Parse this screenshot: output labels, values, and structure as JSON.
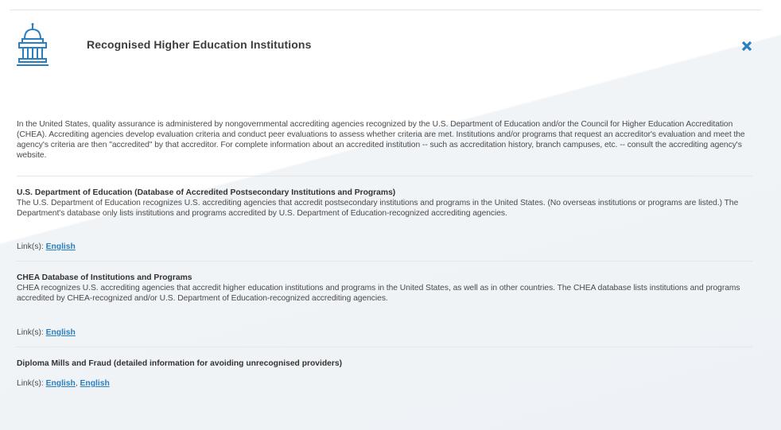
{
  "modal": {
    "title": "Recognised Higher Education Institutions",
    "intro": "In the United States, quality assurance is administered by nongovernmental accrediting agencies recognized by the U.S. Department of Education and/or the Council for Higher Education Accreditation (CHEA). Accrediting agencies develop evaluation criteria and conduct peer evaluations to assess whether criteria are met. Institutions and/or programs that request an accreditor's evaluation and meet the agency's criteria are then \"accredited\" by that accreditor. For complete information about an accredited institution -- such as accreditation history, branch campuses, etc. -- consult the accrediting agency's website.",
    "icons": {
      "header": "institution-building-icon",
      "close": "close-icon"
    },
    "colors": {
      "accent": "#2a7fc0",
      "icon": "#2a7fc0"
    },
    "links_label": "Link(s):",
    "sections": [
      {
        "title": "U.S. Department of Education (Database of Accredited Postsecondary Institutions and Programs)",
        "description": "The U.S. Department of Education recognizes U.S. accrediting agencies that accredit postsecondary institutions and programs in the United States. (No overseas institutions or programs are listed.) The Department's database only lists institutions and programs accredited by U.S. Department of Education-recognized accrediting agencies.",
        "links": [
          "English"
        ]
      },
      {
        "title": "CHEA Database of Institutions and Programs",
        "description": "CHEA recognizes U.S. accrediting agencies that accredit higher education institutions and programs in the United States, as well as in other countries. The CHEA database lists institutions and programs accredited by CHEA-recognized and/or U.S. Department of Education-recognized accrediting agencies.",
        "links": [
          "English"
        ]
      },
      {
        "title": "Diploma Mills and Fraud (detailed information for avoiding unrecognised providers)",
        "description": "",
        "links": [
          "English",
          "English"
        ],
        "link_separator": ","
      }
    ]
  }
}
